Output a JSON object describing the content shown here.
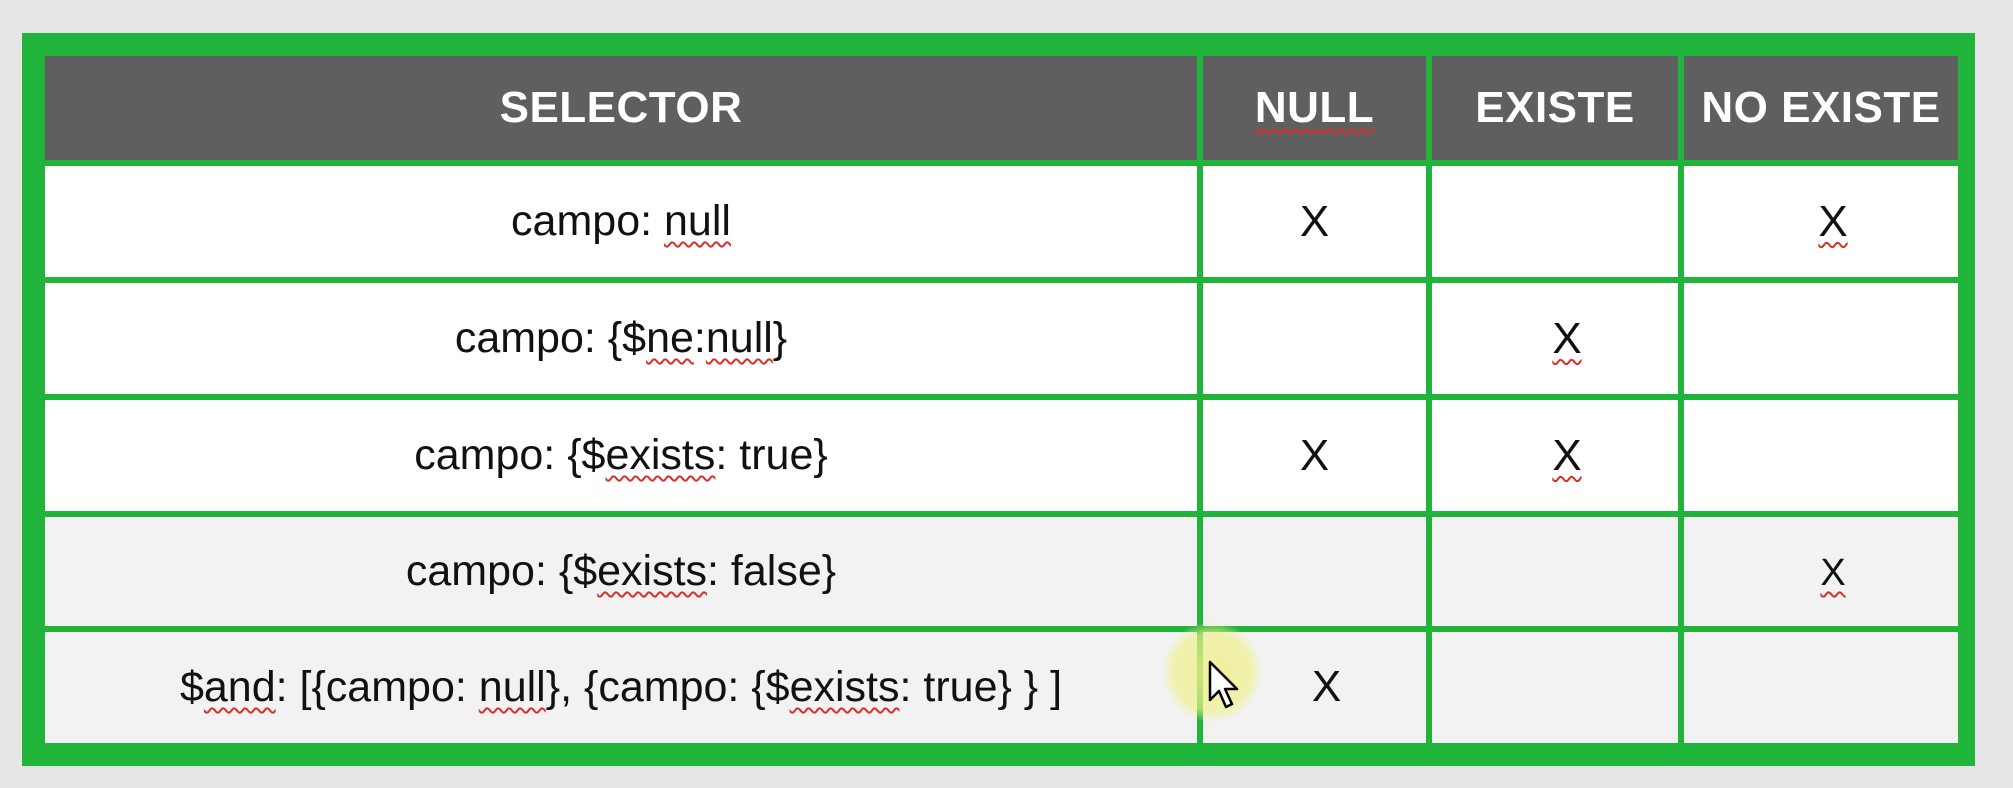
{
  "table": {
    "headers": [
      "SELECTOR",
      "NULL",
      "EXISTE",
      "NO EXISTE"
    ],
    "rows": [
      {
        "selector_parts": [
          "campo: ",
          "null",
          ""
        ],
        "null": "X",
        "existe": "",
        "no_existe": "X"
      },
      {
        "selector_parts": [
          "campo: {$",
          "ne",
          ":",
          "null",
          "}"
        ],
        "null": "",
        "existe": "X",
        "no_existe": ""
      },
      {
        "selector_parts": [
          "campo: {$",
          "exists",
          ": true}"
        ],
        "null": "X",
        "existe": "X",
        "no_existe": ""
      },
      {
        "selector_parts": [
          "campo: {$",
          "exists",
          ": false}"
        ],
        "null": "",
        "existe": "",
        "no_existe": "X"
      },
      {
        "selector_parts": [
          "$",
          "and",
          ": [{campo: ",
          "null",
          "}, {campo: {$",
          "exists",
          ": true} } ]"
        ],
        "null": "X",
        "existe": "",
        "no_existe": ""
      }
    ]
  },
  "colors": {
    "grid_green": "#20b43a",
    "header_bg": "#5f5f5f",
    "spellcheck_red": "#d9302c"
  },
  "icons": {
    "cursor": "mouse-pointer-icon"
  }
}
